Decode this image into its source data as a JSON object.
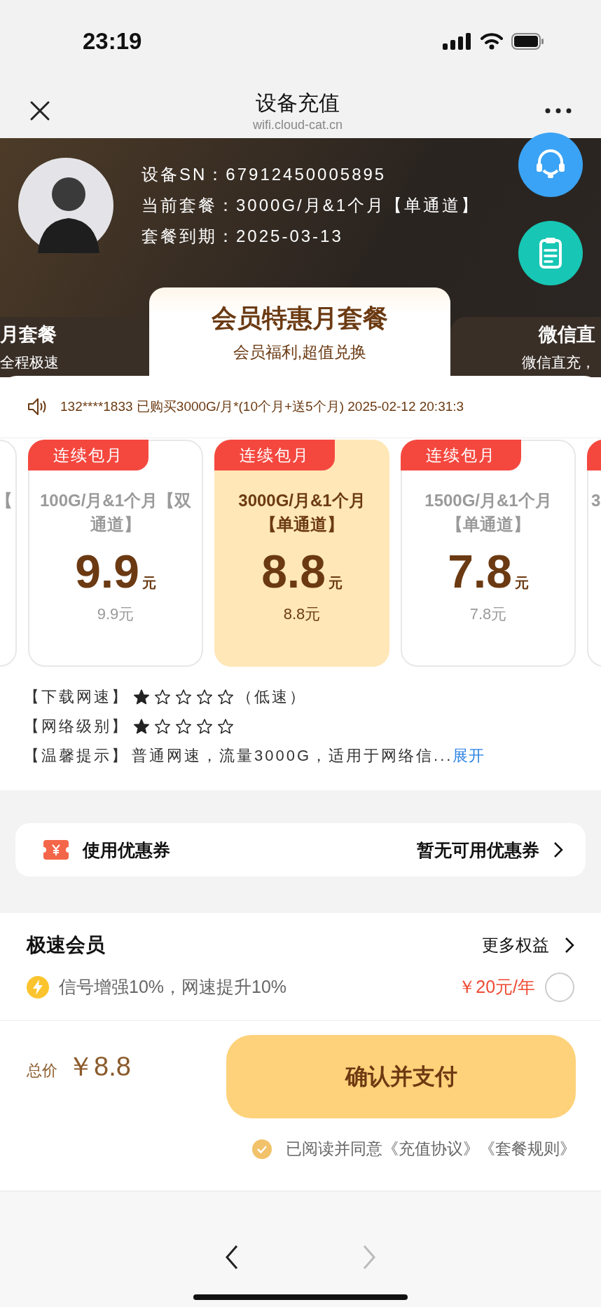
{
  "status_bar": {
    "time": "23:19"
  },
  "nav": {
    "title": "设备充值",
    "subtitle": "wifi.cloud-cat.cn"
  },
  "device": {
    "rows": [
      "设备SN：67912450005895",
      "当前套餐：3000G/月&1个月【单通道】",
      "套餐到期：2025-03-13"
    ]
  },
  "tabs": [
    {
      "title": "月套餐",
      "subtitle": "全程极速",
      "selected": false
    },
    {
      "title": "会员特惠月套餐",
      "subtitle": "会员福利,超值兑换",
      "selected": true
    },
    {
      "title": "微信直",
      "subtitle": "微信直充，",
      "selected": false
    }
  ],
  "notice": "132****1833 已购买3000G/月*(10个月+送5个月) 2025-02-12 20:31:3",
  "packages": [
    {
      "kind": "tail",
      "name": "【"
    },
    {
      "kind": "full",
      "badge": "连续包月",
      "name": "100G/月&1个月【双通道】",
      "price": "9.9",
      "unit": "元",
      "sub_price": "9.9元",
      "selected": false
    },
    {
      "kind": "full",
      "badge": "连续包月",
      "name": "3000G/月&1个月【单通道】",
      "price": "8.8",
      "unit": "元",
      "sub_price": "8.8元",
      "selected": true
    },
    {
      "kind": "full",
      "badge": "连续包月",
      "name": "1500G/月&1个月【单通道】",
      "price": "7.8",
      "unit": "元",
      "sub_price": "7.8元",
      "selected": false
    },
    {
      "kind": "head",
      "name": "3"
    }
  ],
  "details": [
    {
      "label": "【下载网速】",
      "stars": 1,
      "note": "（低速）"
    },
    {
      "label": "【网络级别】",
      "stars": 1
    },
    {
      "label": "【温馨提示】",
      "text": "普通网速，流量3000G，适用于网络信...",
      "link": "展开"
    }
  ],
  "coupon": {
    "label": "使用优惠券",
    "value": "暂无可用优惠券"
  },
  "member": {
    "title": "极速会员",
    "more": "更多权益",
    "desc": "信号增强10%，网速提升10%",
    "price": "￥20元/年",
    "selected": false
  },
  "total": {
    "label": "总价",
    "amount": "￥8.8"
  },
  "pay_button": "确认并支付",
  "agreement": {
    "checked": true,
    "text": "已阅读并同意《充值协议》《套餐规则》"
  },
  "toolbar": {
    "back_disabled": false,
    "forward_disabled": true
  }
}
